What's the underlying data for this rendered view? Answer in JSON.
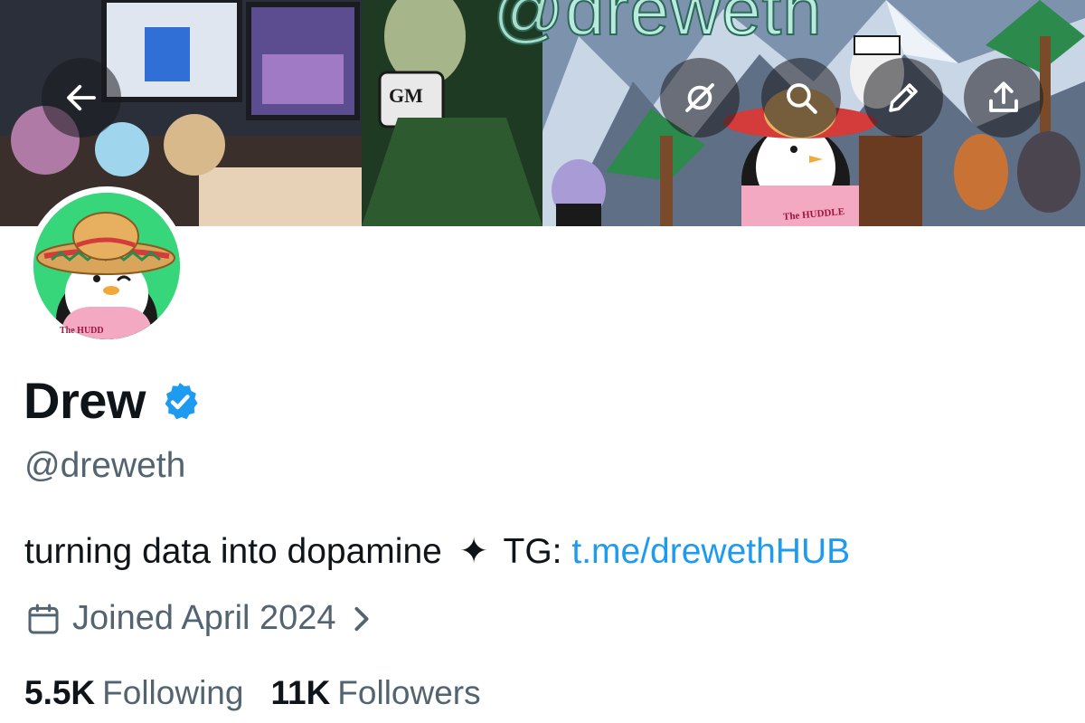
{
  "banner": {
    "handle_art_text": "@dreweth",
    "mug_text": "GM",
    "shirt_text": "The HUDDLE"
  },
  "header_actions": {
    "back": "back-arrow-icon",
    "grok": "grok-icon",
    "search": "search-icon",
    "edit": "pencil-icon",
    "share": "share-icon"
  },
  "profile": {
    "avatar_shirt_text": "The HUDD",
    "display_name": "Drew",
    "verified": true,
    "handle": "@dreweth",
    "bio": {
      "text": "turning data into dopamine",
      "separator": "✦",
      "tg_label": "TG:",
      "link_text": "t.me/drewethHUB"
    },
    "joined": "Joined April 2024",
    "following_count": "5.5K",
    "following_label": "Following",
    "followers_count": "11K",
    "followers_label": "Followers"
  },
  "colors": {
    "text_primary": "#0f1419",
    "text_secondary": "#536471",
    "link": "#1d9bf0",
    "verified_badge": "#1d9bf0",
    "avatar_bg": "#37d67a"
  }
}
